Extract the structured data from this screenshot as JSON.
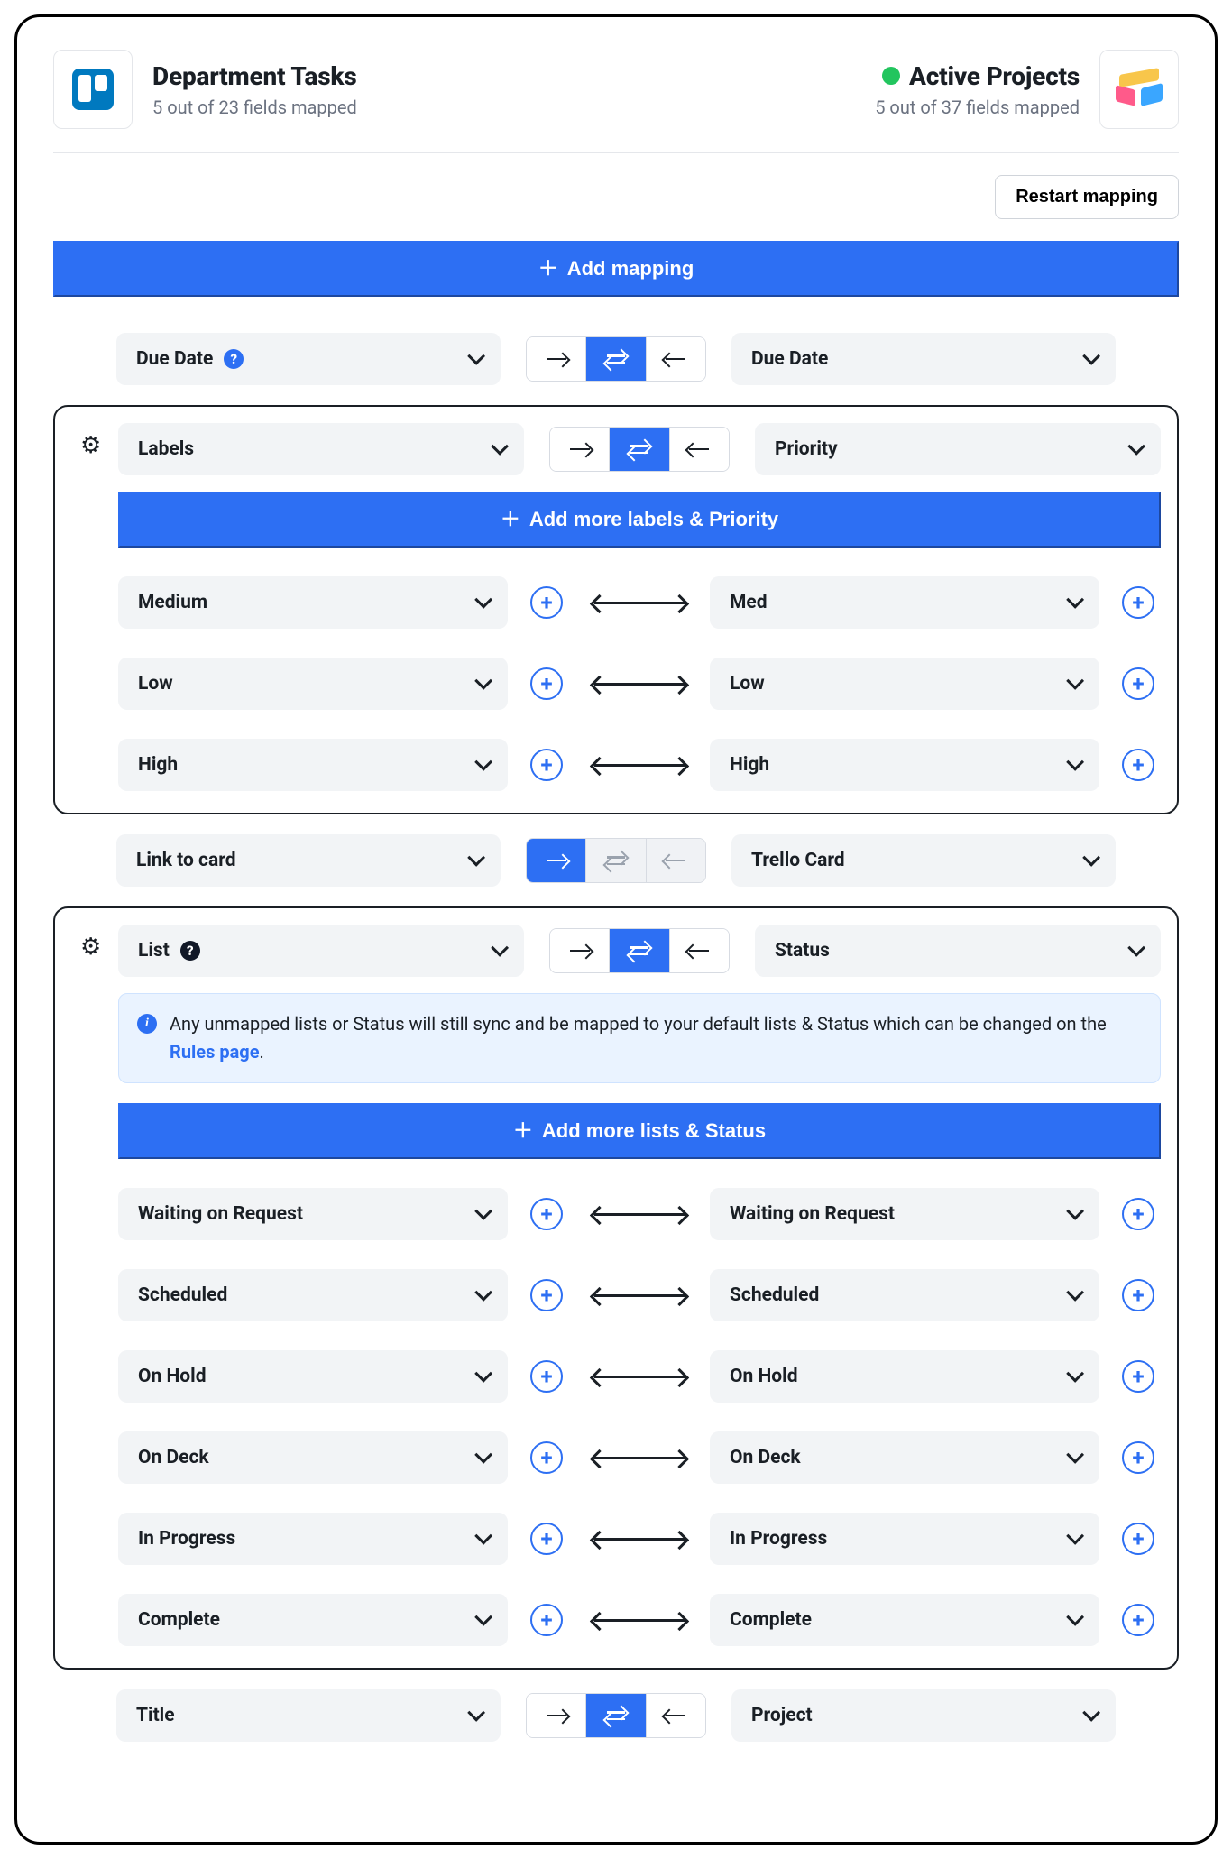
{
  "header": {
    "left": {
      "title": "Department Tasks",
      "sub": "5 out of 23 fields mapped"
    },
    "right": {
      "title": "Active Projects",
      "sub": "5 out of 37 fields mapped"
    }
  },
  "toolbar": {
    "restart": "Restart mapping"
  },
  "add_mapping_label": "Add mapping",
  "rows": {
    "due": {
      "left": "Due Date",
      "right": "Due Date"
    },
    "link": {
      "left": "Link to card",
      "right": "Trello Card"
    },
    "title": {
      "left": "Title",
      "right": "Project"
    }
  },
  "labels_card": {
    "left": "Labels",
    "right": "Priority",
    "add_more": "Add more labels & Priority",
    "pairs": [
      {
        "l": "Medium",
        "r": "Med"
      },
      {
        "l": "Low",
        "r": "Low"
      },
      {
        "l": "High",
        "r": "High"
      }
    ]
  },
  "list_card": {
    "left": "List",
    "right": "Status",
    "info_before": "Any unmapped lists or Status will still sync and be mapped to your default lists & Status which can be changed on the ",
    "info_link": "Rules page",
    "info_after": ".",
    "add_more": "Add more lists & Status",
    "pairs": [
      {
        "l": "Waiting on Request",
        "r": "Waiting on Request"
      },
      {
        "l": "Scheduled",
        "r": "Scheduled"
      },
      {
        "l": "On Hold",
        "r": "On Hold"
      },
      {
        "l": "On Deck",
        "r": "On Deck"
      },
      {
        "l": "In Progress",
        "r": "In Progress"
      },
      {
        "l": "Complete",
        "r": "Complete"
      }
    ]
  }
}
